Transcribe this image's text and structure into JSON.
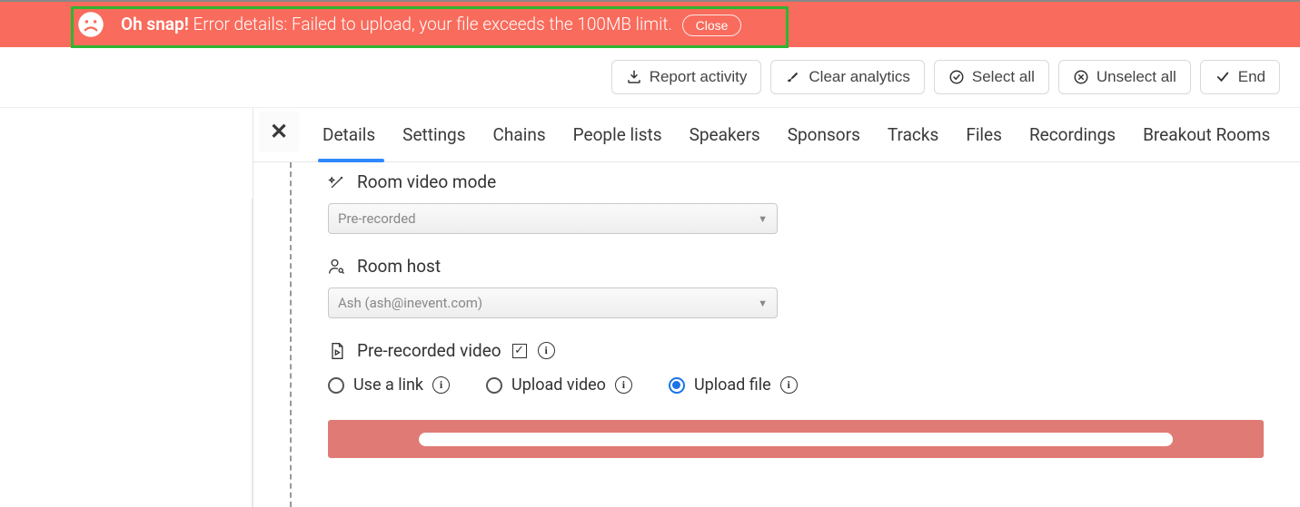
{
  "alert": {
    "title": "Oh snap!",
    "message": "Error details: Failed to upload, your file exceeds the 100MB limit.",
    "close_label": "Close"
  },
  "toolbar": {
    "report": "Report activity",
    "clear": "Clear analytics",
    "select_all": "Select all",
    "unselect_all": "Unselect all",
    "end": "End"
  },
  "tabs": {
    "details": "Details",
    "settings": "Settings",
    "chains": "Chains",
    "people": "People lists",
    "speakers": "Speakers",
    "sponsors": "Sponsors",
    "tracks": "Tracks",
    "files": "Files",
    "recordings": "Recordings",
    "breakout": "Breakout Rooms"
  },
  "fields": {
    "video_mode": {
      "label": "Room video mode",
      "value": "Pre-recorded"
    },
    "host": {
      "label": "Room host",
      "value": "Ash (ash@inevent.com)"
    },
    "prerec": {
      "label": "Pre-recorded video"
    },
    "options": {
      "link": "Use a link",
      "upload_video": "Upload video",
      "upload_file": "Upload file"
    }
  }
}
